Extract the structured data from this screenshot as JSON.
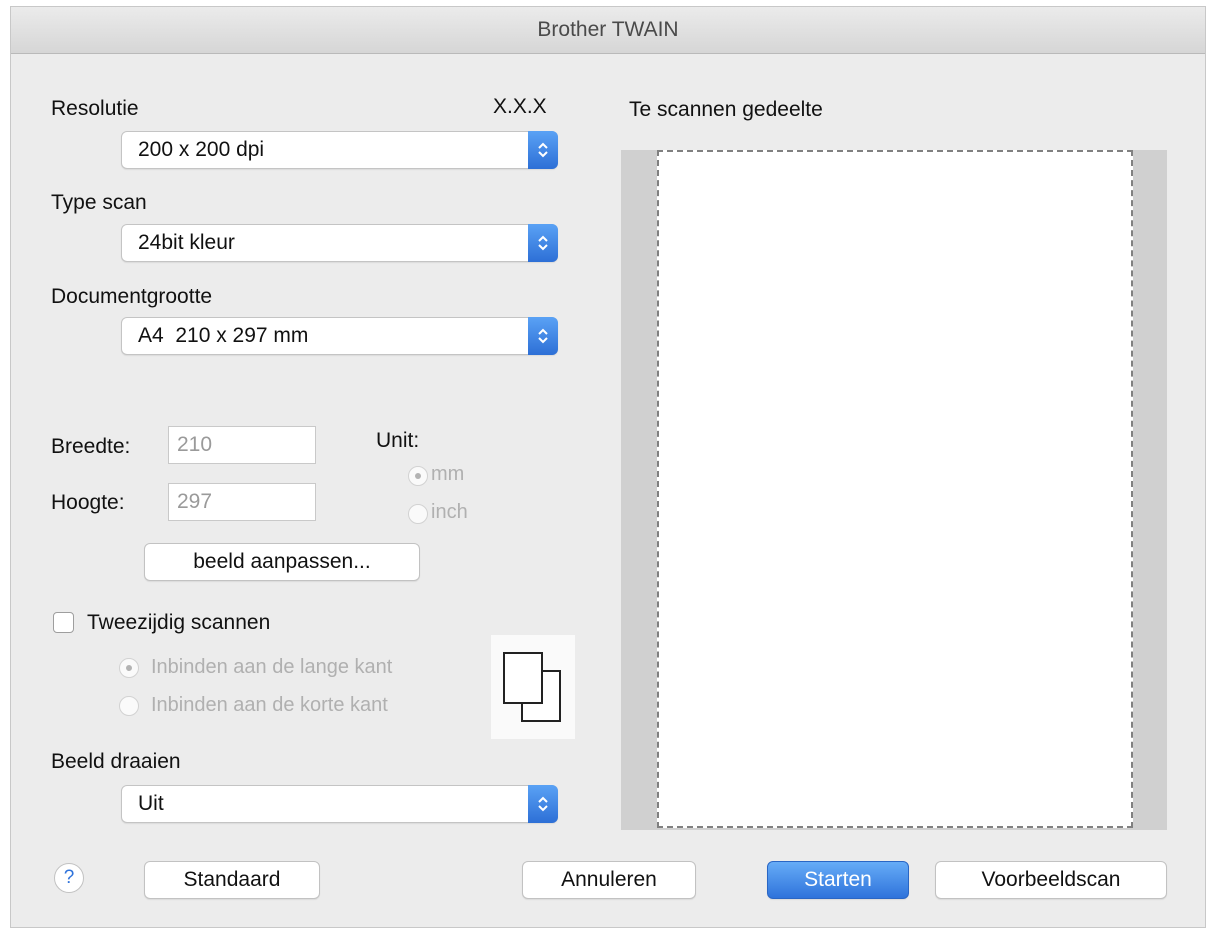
{
  "window": {
    "title": "Brother TWAIN"
  },
  "version": "X.X.X",
  "resolution": {
    "label": "Resolutie",
    "value": "200 x 200 dpi"
  },
  "scan_type": {
    "label": "Type scan",
    "value": "24bit kleur"
  },
  "document_size": {
    "label": "Documentgrootte",
    "value": "A4  210 x 297 mm"
  },
  "dimensions": {
    "width_label": "Breedte:",
    "width_value": "210",
    "height_label": "Hoogte:",
    "height_value": "297",
    "unit_label": "Unit:",
    "unit_options": [
      "mm",
      "inch"
    ],
    "selected_unit": "mm"
  },
  "adjust_button": "beeld aanpassen...",
  "duplex": {
    "label": "Tweezijdig scannen",
    "checked": false,
    "options": [
      "Inbinden aan de lange kant",
      "Inbinden aan de korte kant"
    ],
    "selected": "Inbinden aan de lange kant"
  },
  "rotate": {
    "label": "Beeld draaien",
    "value": "Uit"
  },
  "scan_area": {
    "label": "Te scannen gedeelte"
  },
  "buttons": {
    "help": "?",
    "default": "Standaard",
    "cancel": "Annuleren",
    "start": "Starten",
    "preview": "Voorbeeldscan"
  },
  "colors": {
    "accent": "#2f73db",
    "disabled": "#b0b0b0"
  }
}
